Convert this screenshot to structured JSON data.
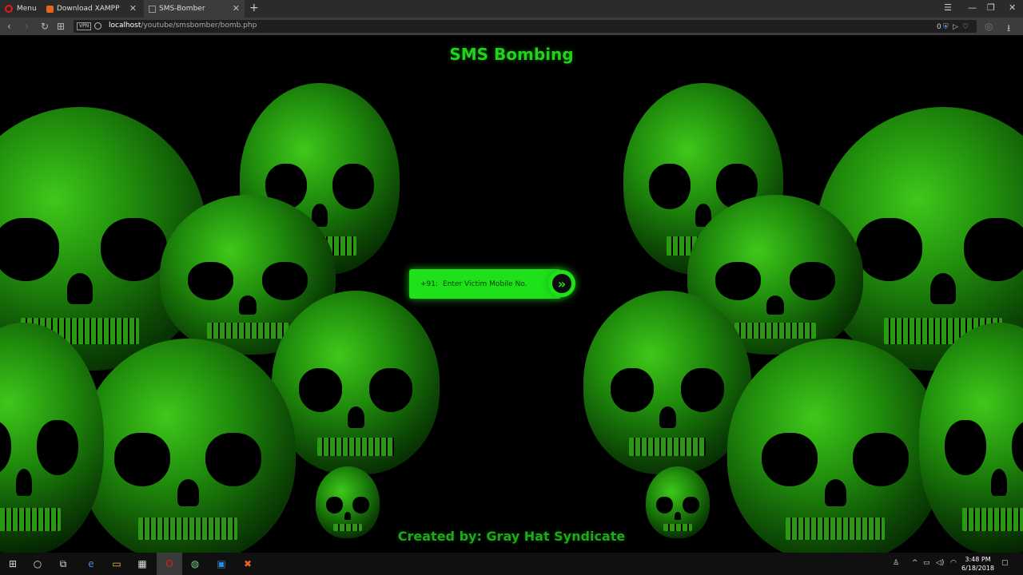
{
  "browser": {
    "menu_label": "Menu",
    "tabs": [
      {
        "title": "Download XAMPP"
      },
      {
        "title": "SMS-Bomber"
      }
    ],
    "vpn_badge": "VPN",
    "url_host": "localhost",
    "url_path": "/youtube/smsbomber/bomb.php",
    "vpn_count": "0"
  },
  "page": {
    "title": "SMS Bombing",
    "form": {
      "prefix": "+91:",
      "placeholder": "Enter Victim Mobile No.",
      "submit_icon": "»"
    },
    "footer": "Created by: Gray Hat Syndicate"
  },
  "taskbar": {
    "time": "3:48 PM",
    "date": "6/18/2018"
  },
  "colors": {
    "accent_green": "#1ee11a",
    "title_green": "#22d11a"
  }
}
